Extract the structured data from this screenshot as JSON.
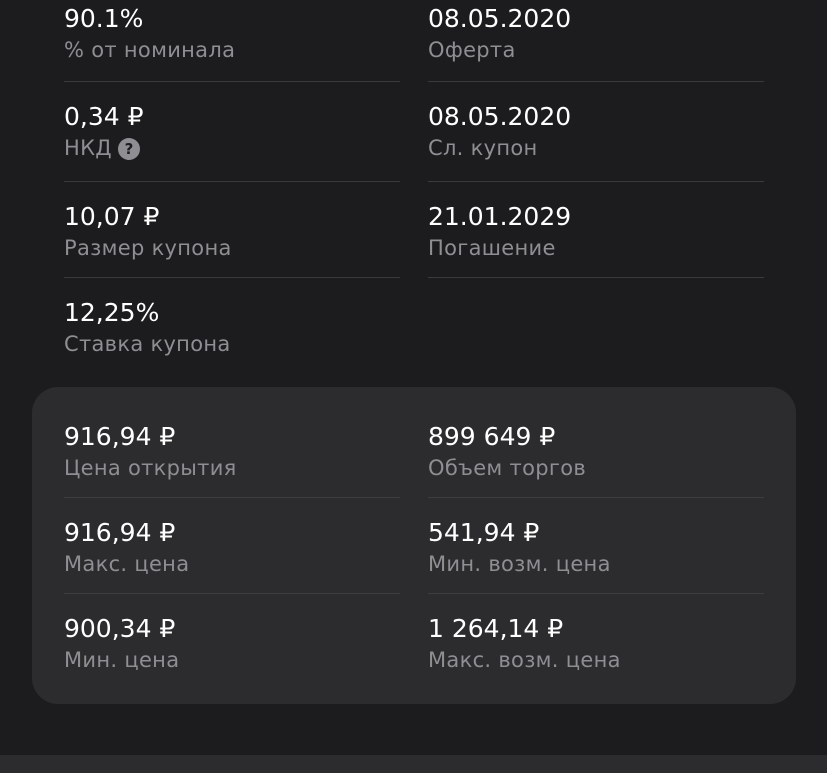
{
  "details": {
    "price_percent": {
      "value": "90.1%",
      "label": "% от номинала"
    },
    "offer": {
      "value": "08.05.2020",
      "label": "Оферта"
    },
    "accrued_interest": {
      "value": "0,34 ₽",
      "label": "НКД",
      "help_icon": "?"
    },
    "next_coupon": {
      "value": "08.05.2020",
      "label": "Сл. купон"
    },
    "coupon_size": {
      "value": "10,07 ₽",
      "label": "Размер купона"
    },
    "maturity": {
      "value": "21.01.2029",
      "label": "Погашение"
    },
    "coupon_rate": {
      "value": "12,25%",
      "label": "Ставка купона"
    }
  },
  "trading": {
    "open_price": {
      "value": "916,94 ₽",
      "label": "Цена открытия"
    },
    "volume": {
      "value": "899 649 ₽",
      "label": "Объем торгов"
    },
    "max_price": {
      "value": "916,94 ₽",
      "label": "Макс. цена"
    },
    "min_possible_price": {
      "value": "541,94 ₽",
      "label": "Мин. возм. цена"
    },
    "min_price": {
      "value": "900,34 ₽",
      "label": "Мин. цена"
    },
    "max_possible_price": {
      "value": "1 264,14 ₽",
      "label": "Макс. возм. цена"
    }
  },
  "colors": {
    "background": "#1c1c1e",
    "card": "#2c2c2e",
    "text_primary": "#ffffff",
    "text_secondary": "#8e8e93",
    "divider": "#3a3a3c"
  }
}
